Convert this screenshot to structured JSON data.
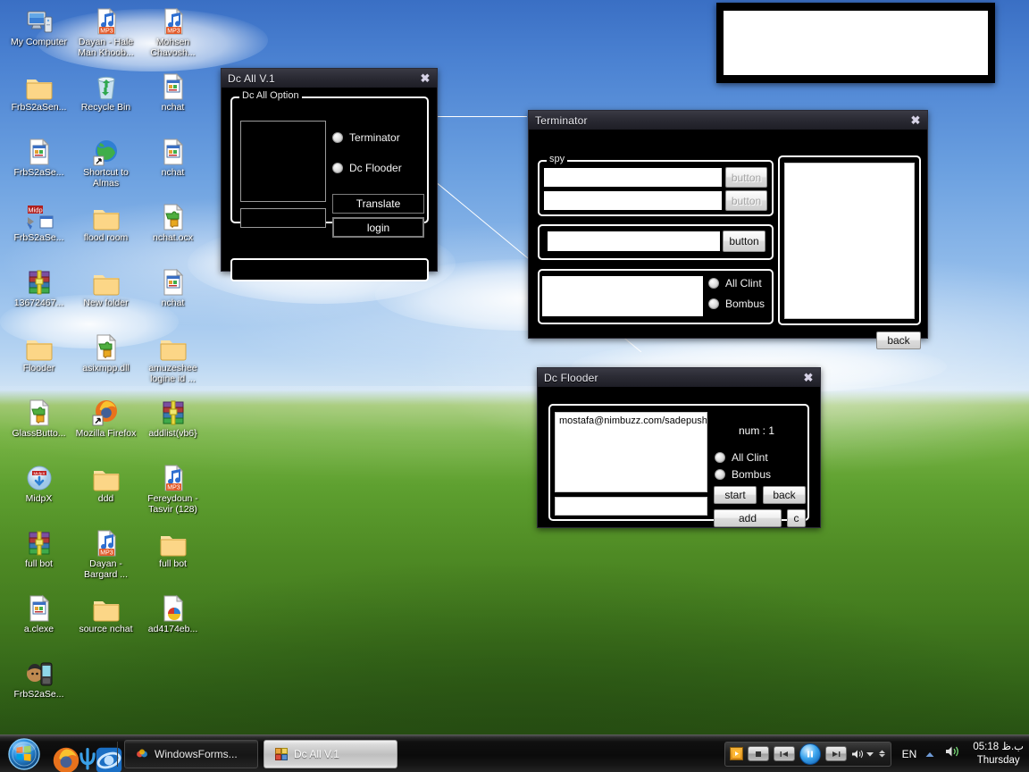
{
  "desktop": {
    "icons": [
      {
        "label": "My Computer",
        "icon": "my-computer-icon",
        "type": "computer"
      },
      {
        "label": "Dayan - Hale Man Khoob...",
        "icon": "mp3-file-icon",
        "type": "mp3"
      },
      {
        "label": "Mohsen Chavosh...",
        "icon": "mp3-file-icon",
        "type": "mp3"
      },
      {
        "label": "FrbS2aSen...",
        "icon": "folder-icon",
        "type": "folder"
      },
      {
        "label": "Recycle Bin",
        "icon": "recycle-bin-icon",
        "type": "recycle"
      },
      {
        "label": "nchat",
        "icon": "ocx-file-icon",
        "type": "ocx"
      },
      {
        "label": "FrbS2aSe...",
        "icon": "ocx-file-icon",
        "type": "ocx"
      },
      {
        "label": "Shortcut to Almas",
        "icon": "globe-shortcut-icon",
        "type": "globe"
      },
      {
        "label": "nchat",
        "icon": "ocx-file-icon",
        "type": "ocx"
      },
      {
        "label": "FrbS2aSe...",
        "icon": "midp-icon",
        "type": "midp"
      },
      {
        "label": "flood room",
        "icon": "folder-icon",
        "type": "folder"
      },
      {
        "label": "nchat.ocx",
        "icon": "puzzle-file-icon",
        "type": "puzzle"
      },
      {
        "label": "13672467...",
        "icon": "winrar-archive-icon",
        "type": "rar"
      },
      {
        "label": "New folder",
        "icon": "folder-icon",
        "type": "folder"
      },
      {
        "label": "nchat",
        "icon": "ocx-file-icon",
        "type": "ocx"
      },
      {
        "label": "Flooder",
        "icon": "folder-icon",
        "type": "folder"
      },
      {
        "label": "asixmpp.dll",
        "icon": "puzzle-file-icon",
        "type": "puzzle"
      },
      {
        "label": "amuzeshee logine id ...",
        "icon": "folder-icon",
        "type": "folder"
      },
      {
        "label": "GlassButto...",
        "icon": "puzzle-file-icon",
        "type": "puzzle"
      },
      {
        "label": "Mozilla Firefox",
        "icon": "firefox-shortcut-icon",
        "type": "firefox"
      },
      {
        "label": "addlist(vb6}",
        "icon": "winrar-archive-icon",
        "type": "rar"
      },
      {
        "label": "MidpX",
        "icon": "midpx-icon",
        "type": "midpx"
      },
      {
        "label": "ddd",
        "icon": "folder-icon",
        "type": "folder"
      },
      {
        "label": "Fereydoun - Tasvir (128)",
        "icon": "mp3-file-icon",
        "type": "mp3"
      },
      {
        "label": "full bot",
        "icon": "winrar-archive-icon",
        "type": "rar"
      },
      {
        "label": "Dayan - Bargard ...",
        "icon": "mp3-file-icon",
        "type": "mp3"
      },
      {
        "label": "full bot",
        "icon": "folder-icon",
        "type": "folder"
      },
      {
        "label": "a.clexe",
        "icon": "ocx-file-icon",
        "type": "ocx"
      },
      {
        "label": "source nchat",
        "icon": "folder-icon",
        "type": "folder"
      },
      {
        "label": "ad4174eb...",
        "icon": "image-file-icon",
        "type": "image"
      },
      {
        "label": "FrbS2aSe...",
        "icon": "mobile-app-icon",
        "type": "mobile"
      }
    ]
  },
  "dc_all_window": {
    "title": "Dc All V.1",
    "close_label": "✖",
    "group_title": "Dc All Option",
    "radios": [
      {
        "label": "Terminator",
        "selected": false
      },
      {
        "label": "Dc Flooder",
        "selected": false
      }
    ],
    "buttons": [
      {
        "label": "Translate"
      },
      {
        "label": "login"
      }
    ],
    "list_value": "",
    "small_text_value": "",
    "status_value": ""
  },
  "terminator_window": {
    "title": "Terminator",
    "close_label": "✖",
    "spy_group_title": "spy",
    "spy_rows": [
      {
        "value": "",
        "button_label": "button",
        "disabled": true
      },
      {
        "value": "",
        "button_label": "button",
        "disabled": true
      }
    ],
    "mid_row": {
      "value": "",
      "button_label": "button",
      "disabled": false
    },
    "bottom_row": {
      "value": "",
      "radios": [
        {
          "label": "All Clint",
          "selected": false
        },
        {
          "label": "Bombus",
          "selected": false
        }
      ]
    },
    "log_value": "",
    "back_label": "back"
  },
  "dc_flooder_window": {
    "title": "Dc Flooder",
    "close_label": "✖",
    "list_value": "mostafa@nimbuzz.com/sadepush",
    "num_label": "num : 1",
    "radios": [
      {
        "label": "All Clint",
        "selected": false
      },
      {
        "label": "Bombus",
        "selected": false
      }
    ],
    "buttons": {
      "start": "start",
      "back": "back",
      "add": "add",
      "clear": "c"
    },
    "input_value": ""
  },
  "floating_panel": {
    "list_value": ""
  },
  "taskbar": {
    "start_label": "start",
    "quick_launch": [
      {
        "name": "firefox-icon"
      },
      {
        "name": "psi-icon"
      },
      {
        "name": "ie-icon"
      }
    ],
    "tasks": [
      {
        "label": "WindowsForms...",
        "active": false,
        "icon": "windowsforms-icon"
      },
      {
        "label": "Dc All V.1",
        "active": true,
        "icon": "vb-app-icon"
      }
    ],
    "tray": {
      "language": "EN",
      "volume_icon": "volume-icon",
      "show_hidden_icon": "chevron-up-icon",
      "media_buttons": [
        "stop-button",
        "previous-button",
        "play-pause-button",
        "next-button",
        "mute-button"
      ],
      "clock_time": "05:18 ب.ظ",
      "clock_day": "Thursday"
    }
  },
  "colors": {
    "window_bg": "#000000",
    "window_title_bg": "#2b2b34",
    "accent_white": "#ffffff",
    "taskbar_bg": "#101010",
    "desktop_sky": "#4b82d2",
    "desktop_grass": "#63a832"
  }
}
